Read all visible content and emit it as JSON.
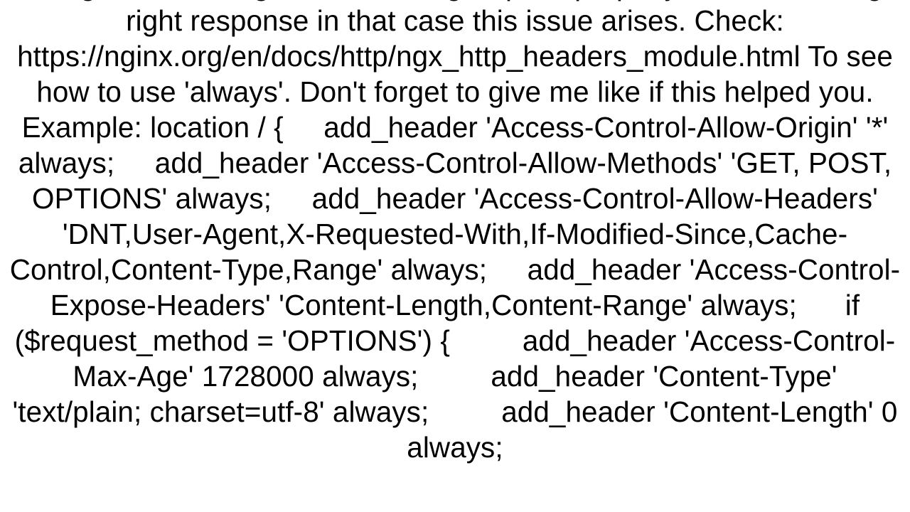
{
  "content": {
    "body": "using header in Nginx or returning request properly or not returning right response in that case this issue arises. Check: https://nginx.org/en/docs/http/ngx_http_headers_module.html To see how to use 'always'. Don't forget to give me like if this helped you. Example: location / {     add_header 'Access-Control-Allow-Origin' '*' always;     add_header 'Access-Control-Allow-Methods' 'GET, POST, OPTIONS' always;     add_header 'Access-Control-Allow-Headers' 'DNT,User-Agent,X-Requested-With,If-Modified-Since,Cache-Control,Content-Type,Range' always;     add_header 'Access-Control-Expose-Headers' 'Content-Length,Content-Range' always;      if ($request_method = 'OPTIONS') {         add_header 'Access-Control-Max-Age' 1728000 always;         add_header 'Content-Type' 'text/plain; charset=utf-8' always;         add_header 'Content-Length' 0 always;"
  }
}
